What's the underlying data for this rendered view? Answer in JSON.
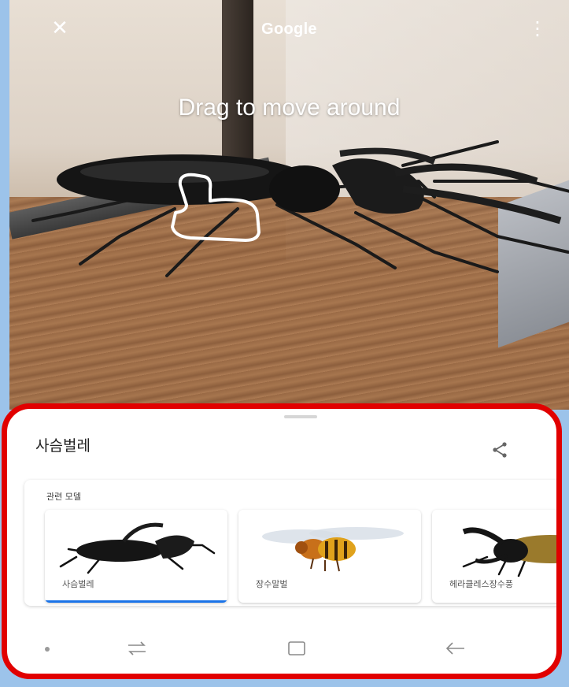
{
  "topbar": {
    "title": "Google",
    "close_icon": "close-icon",
    "more_icon": "more-vert-icon"
  },
  "camera": {
    "hint": "Drag to move around",
    "gesture_icon": "drag-hand-icon"
  },
  "sheet": {
    "title": "사슴벌레",
    "share_icon": "share-icon",
    "related_label": "관련 모델",
    "cards": [
      {
        "label": "사슴벌레",
        "selected": true
      },
      {
        "label": "장수말벌",
        "selected": false
      },
      {
        "label": "헤라클레스장수풍",
        "selected": false
      }
    ]
  },
  "navbar": {
    "icons": [
      "dot-icon",
      "recent-apps-icon",
      "home-icon",
      "back-icon"
    ]
  },
  "colors": {
    "highlight_border": "#e10000",
    "selected_underline": "#1a73e8"
  }
}
